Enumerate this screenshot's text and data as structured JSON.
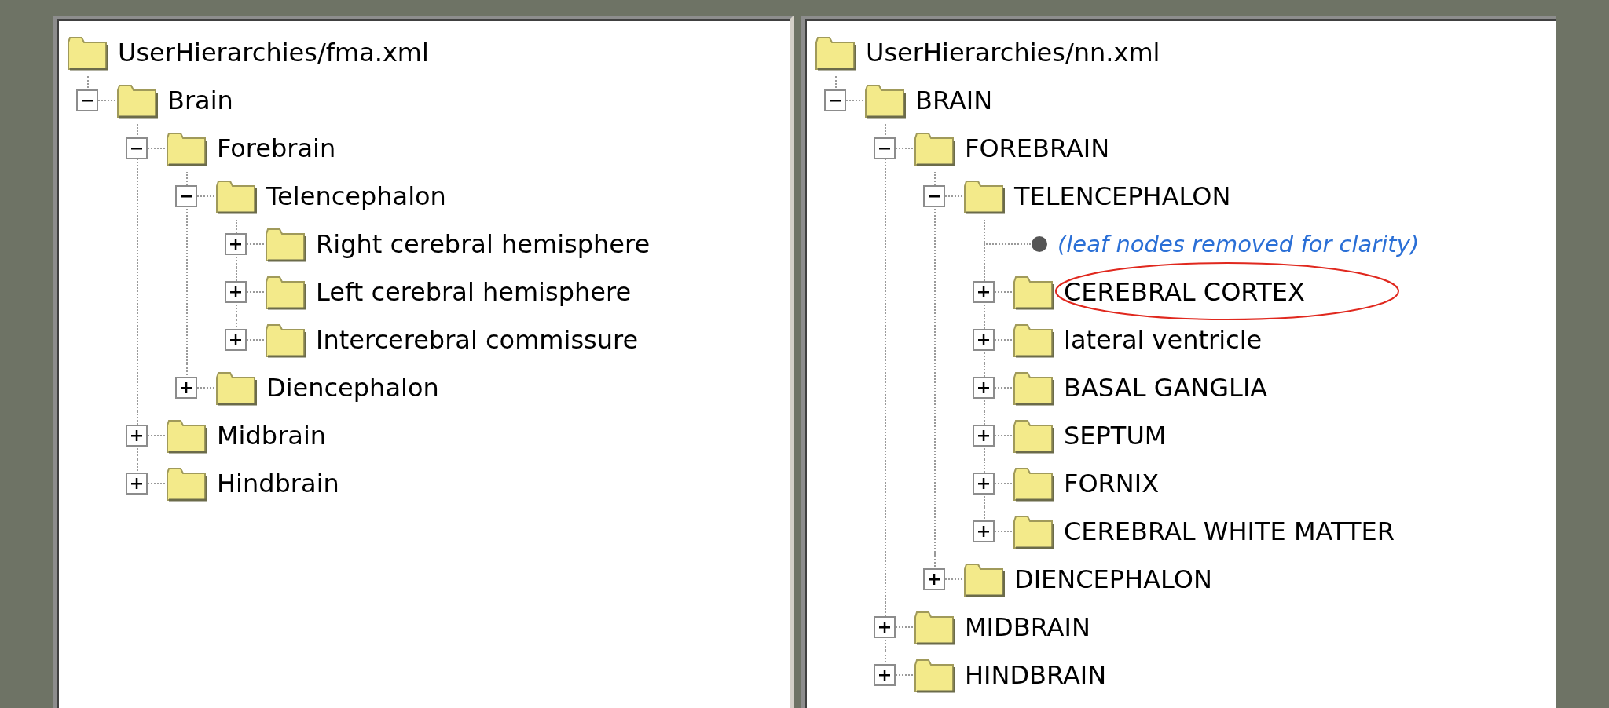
{
  "panels": [
    {
      "title": "UserHierarchies/fma.xml",
      "nodes": [
        {
          "kind": "folder",
          "label": "Brain",
          "expanded": true,
          "circled": false,
          "children": [
            {
              "kind": "folder",
              "label": "Forebrain",
              "expanded": true,
              "circled": false,
              "children": [
                {
                  "kind": "folder",
                  "label": "Telencephalon",
                  "expanded": true,
                  "circled": false,
                  "children": [
                    {
                      "kind": "folder",
                      "label": "Right cerebral hemisphere",
                      "expanded": false,
                      "circled": false
                    },
                    {
                      "kind": "folder",
                      "label": "Left cerebral hemisphere",
                      "expanded": false,
                      "circled": false
                    },
                    {
                      "kind": "folder",
                      "label": "Intercerebral commissure",
                      "expanded": false,
                      "circled": false
                    }
                  ]
                },
                {
                  "kind": "folder",
                  "label": "Diencephalon",
                  "expanded": false,
                  "circled": false
                }
              ]
            },
            {
              "kind": "folder",
              "label": "Midbrain",
              "expanded": false,
              "circled": false
            },
            {
              "kind": "folder",
              "label": "Hindbrain",
              "expanded": false,
              "circled": false
            }
          ]
        }
      ]
    },
    {
      "title": "UserHierarchies/nn.xml",
      "nodes": [
        {
          "kind": "folder",
          "label": "BRAIN",
          "expanded": true,
          "circled": false,
          "children": [
            {
              "kind": "folder",
              "label": "FOREBRAIN",
              "expanded": true,
              "circled": false,
              "children": [
                {
                  "kind": "folder",
                  "label": "TELENCEPHALON",
                  "expanded": true,
                  "circled": false,
                  "children": [
                    {
                      "kind": "note",
                      "label": "(leaf nodes removed for clarity)"
                    },
                    {
                      "kind": "folder",
                      "label": "CEREBRAL CORTEX",
                      "expanded": false,
                      "circled": true
                    },
                    {
                      "kind": "folder",
                      "label": "lateral ventricle",
                      "expanded": false,
                      "circled": false
                    },
                    {
                      "kind": "folder",
                      "label": "BASAL GANGLIA",
                      "expanded": false,
                      "circled": false
                    },
                    {
                      "kind": "folder",
                      "label": "SEPTUM",
                      "expanded": false,
                      "circled": false
                    },
                    {
                      "kind": "folder",
                      "label": "FORNIX",
                      "expanded": false,
                      "circled": false
                    },
                    {
                      "kind": "folder",
                      "label": "CEREBRAL WHITE MATTER",
                      "expanded": false,
                      "circled": false
                    }
                  ]
                },
                {
                  "kind": "folder",
                  "label": "DIENCEPHALON",
                  "expanded": false,
                  "circled": false
                }
              ]
            },
            {
              "kind": "folder",
              "label": "MIDBRAIN",
              "expanded": false,
              "circled": false
            },
            {
              "kind": "folder",
              "label": "HINDBRAIN",
              "expanded": false,
              "circled": false
            }
          ]
        }
      ]
    }
  ]
}
